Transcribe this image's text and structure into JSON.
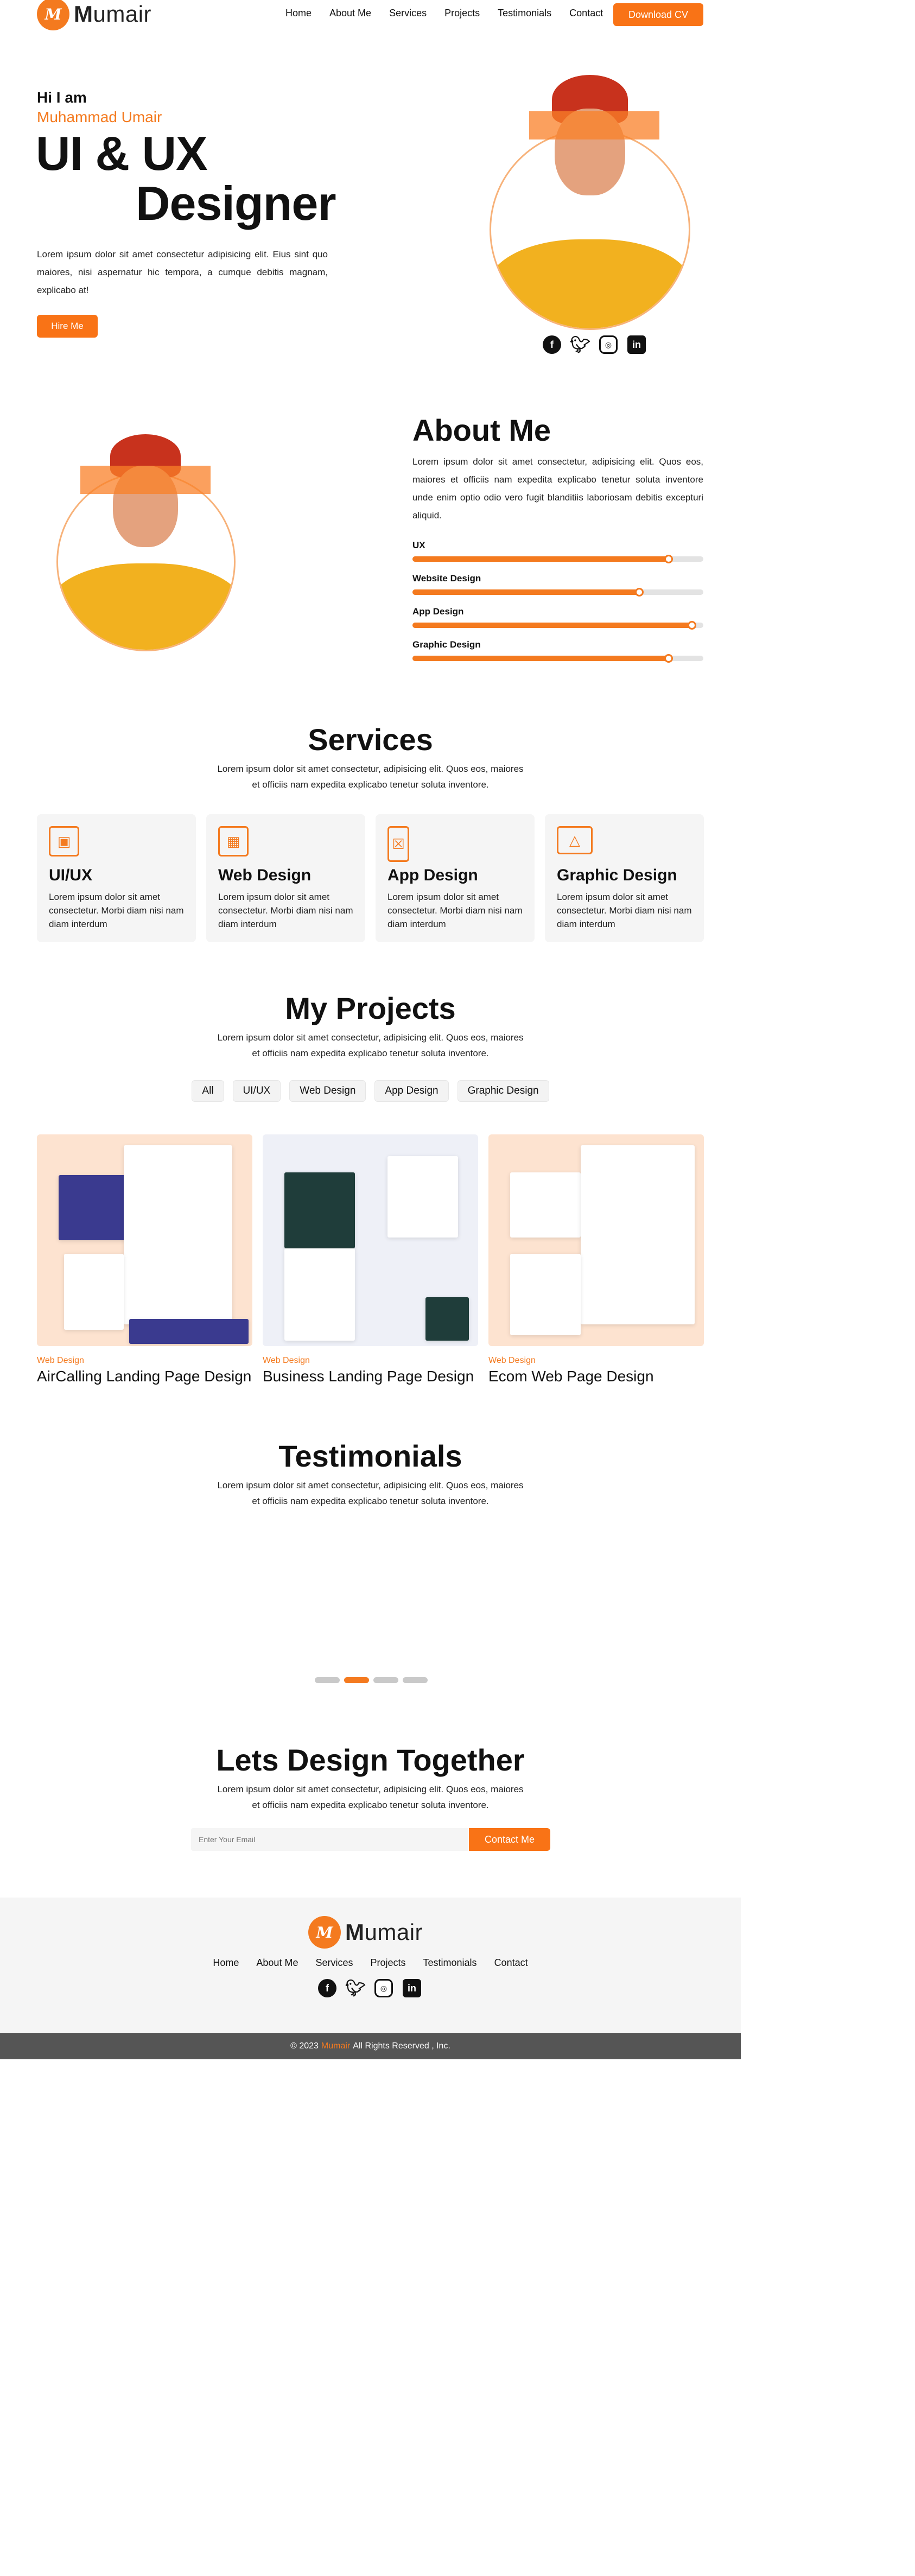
{
  "brand": {
    "mark": "M",
    "name_bold": "M",
    "name_rest": "umair"
  },
  "nav": {
    "links": [
      "Home",
      "About Me",
      "Services",
      "Projects",
      "Testimonials",
      "Contact"
    ],
    "cta": "Download CV"
  },
  "hero": {
    "greeting": "Hi I am",
    "name": "Muhammad Umair",
    "title_line1": "UI & UX",
    "title_line2": "Designer",
    "description": "Lorem ipsum dolor sit amet consectetur adipisicing elit. Eius sint quo maiores, nisi aspernatur hic tempora, a cumque debitis magnam, explicabo at!",
    "button": "Hire Me"
  },
  "social_icons": [
    "facebook-icon",
    "twitter-icon",
    "instagram-icon",
    "linkedin-icon"
  ],
  "about": {
    "title": "About Me",
    "description": "Lorem ipsum dolor sit amet consectetur, adipisicing elit. Quos eos, maiores et officiis nam expedita explicabo tenetur soluta inventore unde enim optio odio vero fugit blanditiis laboriosam debitis excepturi aliquid.",
    "skills": [
      {
        "label": "UX",
        "level": 0.88
      },
      {
        "label": "Website Design",
        "level": 0.78
      },
      {
        "label": "App Design",
        "level": 0.96
      },
      {
        "label": "Graphic Design",
        "level": 0.88
      }
    ]
  },
  "services": {
    "title": "Services",
    "subtitle_line1": "Lorem ipsum dolor sit amet consectetur, adipisicing elit. Quos eos, maiores",
    "subtitle_line2": "et officiis nam expedita explicabo tenetur soluta inventore.",
    "cards": [
      {
        "name": "UI/UX",
        "desc": "Lorem ipsum dolor sit amet consectetur. Morbi diam nisi nam diam interdum",
        "icon": "ui-ux-icon"
      },
      {
        "name": "Web Design",
        "desc": "Lorem ipsum dolor sit amet consectetur. Morbi diam nisi nam diam interdum",
        "icon": "web-design-icon"
      },
      {
        "name": "App Design",
        "desc": "Lorem ipsum dolor sit amet consectetur. Morbi diam nisi nam diam interdum",
        "icon": "app-design-icon"
      },
      {
        "name": "Graphic Design",
        "desc": "Lorem ipsum dolor sit amet consectetur. Morbi diam nisi nam diam interdum",
        "icon": "graphic-design-icon"
      }
    ]
  },
  "projects": {
    "title": "My Projects",
    "subtitle_line1": "Lorem ipsum dolor sit amet consectetur, adipisicing elit. Quos eos, maiores",
    "subtitle_line2": "et officiis nam expedita explicabo tenetur soluta inventore.",
    "filters": [
      "All",
      "UI/UX",
      "Web Design",
      "App Design",
      "Graphic Design"
    ],
    "items": [
      {
        "category": "Web Design",
        "name": "AirCalling Landing Page Design"
      },
      {
        "category": "Web Design",
        "name": "Business Landing Page Design"
      },
      {
        "category": "Web Design",
        "name": "Ecom Web Page Design"
      }
    ]
  },
  "testimonials": {
    "title": "Testimonials",
    "subtitle_line1": "Lorem ipsum dolor sit amet consectetur, adipisicing elit. Quos eos, maiores",
    "subtitle_line2": "et officiis nam expedita explicabo tenetur soluta inventore.",
    "active_slide": 2,
    "slide_count": 4
  },
  "cta": {
    "title": "Lets Design Together",
    "subtitle_line1": "Lorem ipsum dolor sit amet consectetur, adipisicing elit. Quos eos, maiores",
    "subtitle_line2": "et officiis nam expedita explicabo tenetur soluta inventore.",
    "placeholder": "Enter Your Email",
    "button": "Contact Me"
  },
  "footer": {
    "links": [
      "Home",
      "About Me",
      "Services",
      "Projects",
      "Testimonials",
      "Contact"
    ],
    "copyright_prefix": "© 2023",
    "copyright_brand": "Mumair",
    "copyright_suffix": "All Rights Reserved , Inc."
  },
  "colors": {
    "accent": "#f47a1f",
    "button": "#f97316",
    "footer_bg": "#f5f5f5",
    "copyright_bg": "#555555"
  }
}
